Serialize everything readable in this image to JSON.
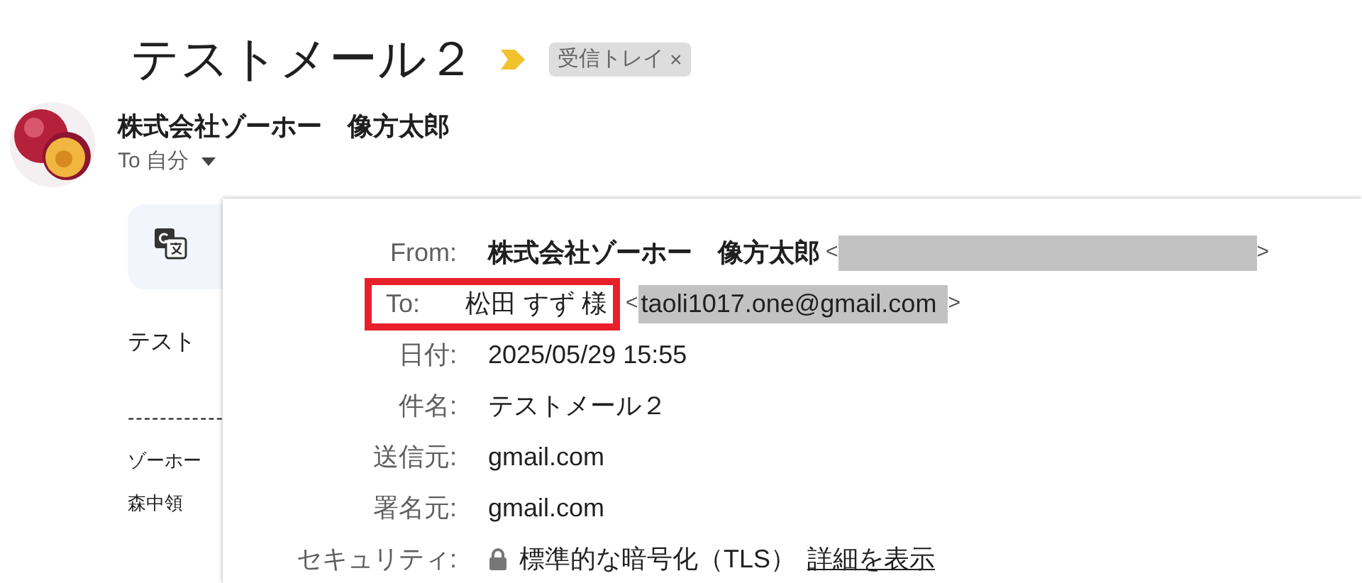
{
  "subject": {
    "title": "テストメール２",
    "label": "受信トレイ",
    "label_close": "×"
  },
  "sender": {
    "name": "株式会社ゾーホー　像方太郎",
    "to": "To 自分"
  },
  "body": {
    "lines": [
      {
        "kind": "text",
        "text": "テスト"
      },
      {
        "kind": "rule",
        "text": "------------"
      },
      {
        "kind": "small",
        "text": "ゾーホー"
      },
      {
        "kind": "small",
        "text": "森中領"
      }
    ]
  },
  "details": {
    "rows": [
      {
        "kind": "address",
        "label": "From:",
        "value": "株式会社ゾーホー　像方太郎",
        "bold": true,
        "highlighted": false,
        "open": "<",
        "address": "",
        "close": ">"
      },
      {
        "kind": "address",
        "label": "To:",
        "value": "松田 すず 様",
        "bold": false,
        "highlighted": true,
        "open": "<",
        "address": "taoli1017.one@gmail.com",
        "close": ">"
      },
      {
        "kind": "text",
        "label": "日付:",
        "value": "2025/05/29 15:55"
      },
      {
        "kind": "text",
        "label": "件名:",
        "value": "テストメール２"
      },
      {
        "kind": "text",
        "label": "送信元:",
        "value": "gmail.com"
      },
      {
        "kind": "text",
        "label": "署名元:",
        "value": "gmail.com"
      },
      {
        "kind": "security",
        "label": "セキュリティ:",
        "value": "標準的な暗号化（TLS）",
        "link": "詳細を表示"
      }
    ]
  }
}
